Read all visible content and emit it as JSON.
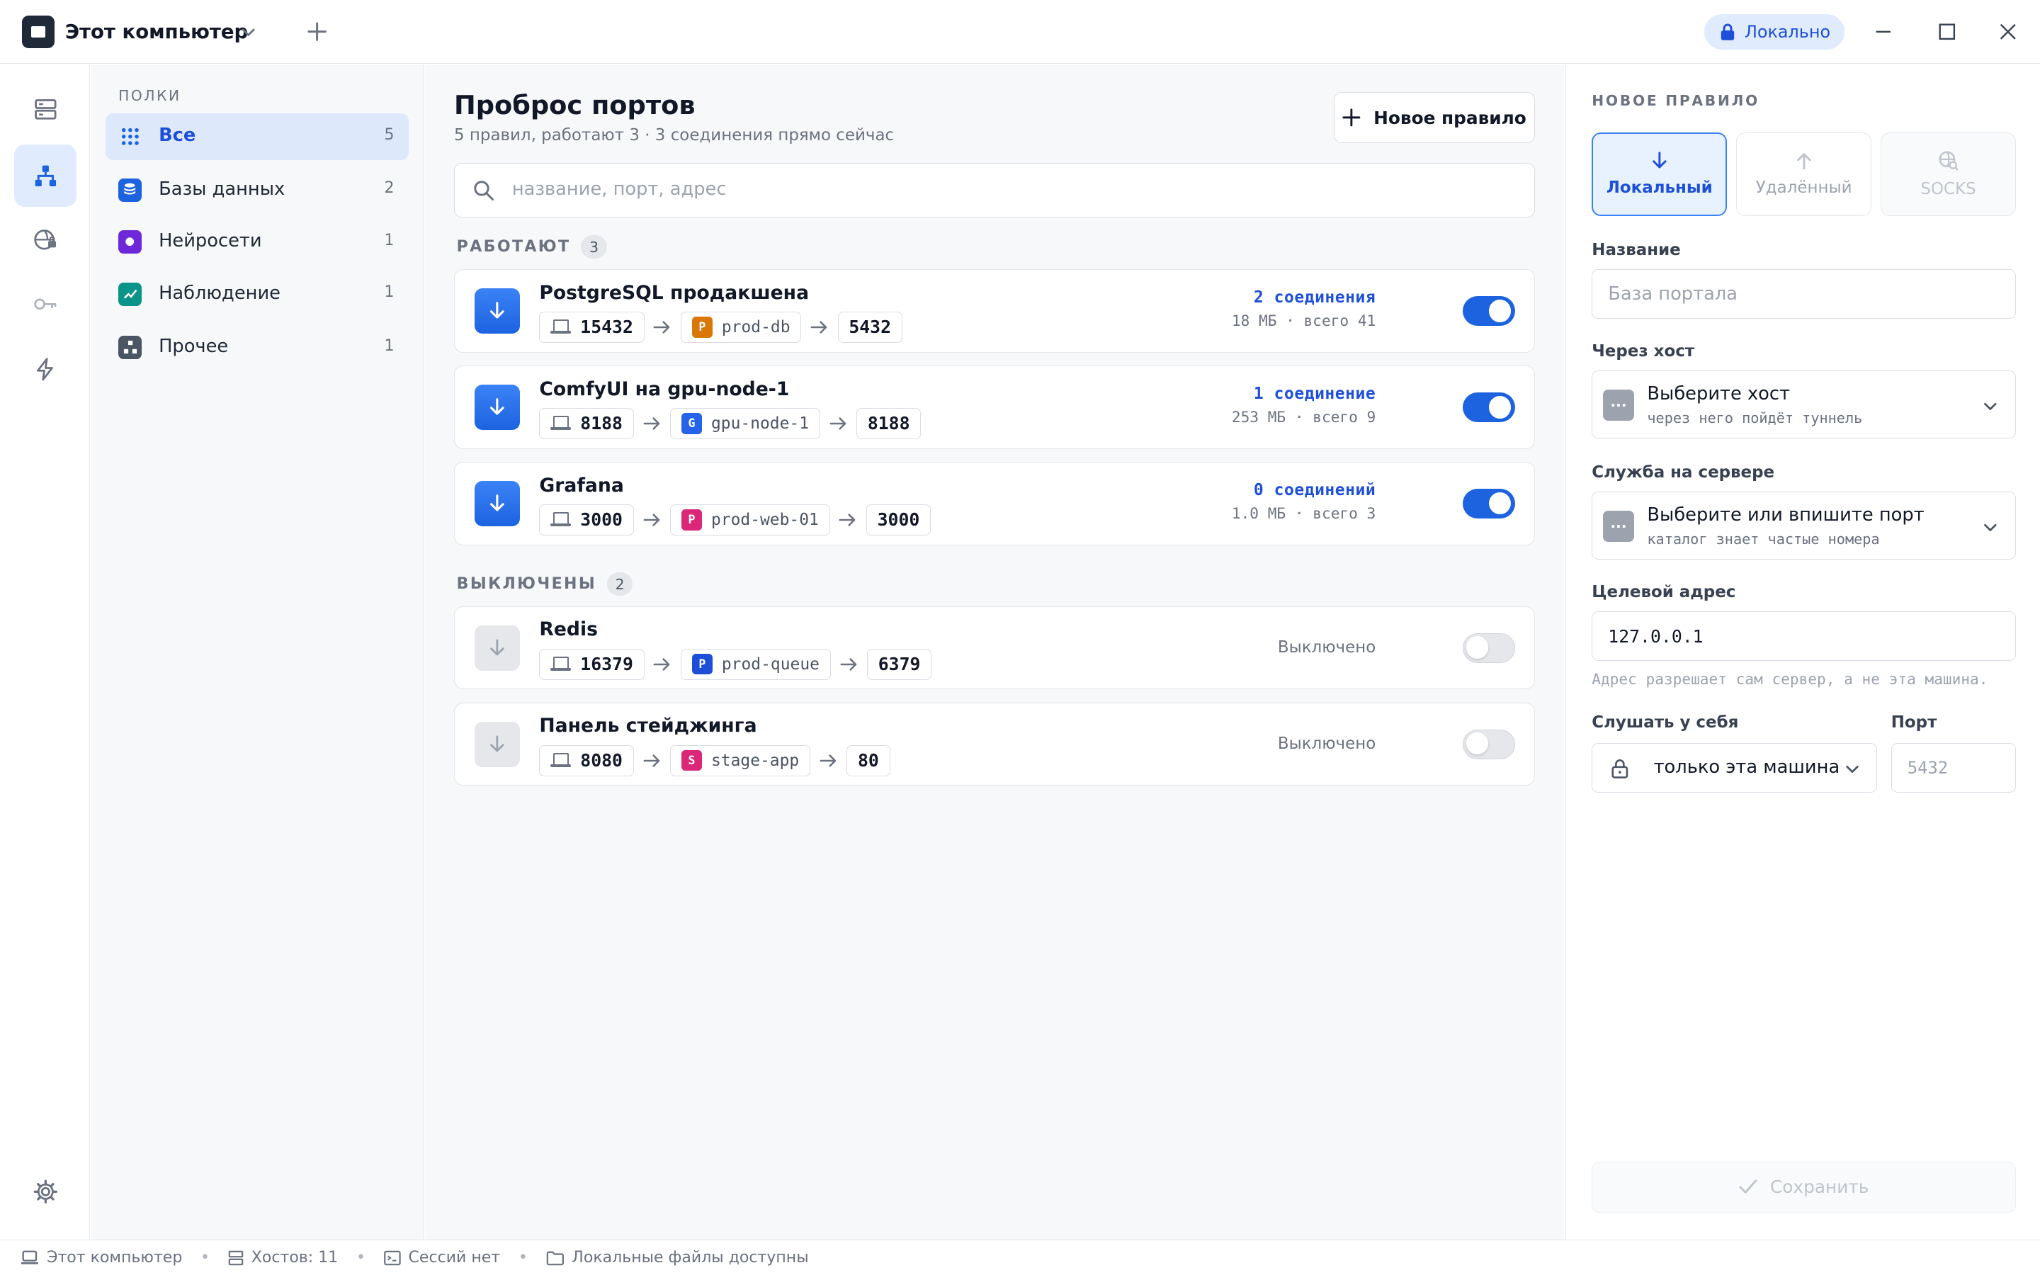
{
  "window": {
    "title": "Этот компьютер",
    "mode_badge": "Локально"
  },
  "sidebar": {
    "heading": "ПОЛКИ",
    "items": [
      {
        "label": "Все",
        "count": "5",
        "icon": "grid-icon",
        "color": "#dde9fb"
      },
      {
        "label": "Базы данных",
        "count": "2",
        "icon": "database-icon",
        "color": "#1d63e0"
      },
      {
        "label": "Нейросети",
        "count": "1",
        "icon": "ai-icon",
        "color": "#6d28d9"
      },
      {
        "label": "Наблюдение",
        "count": "1",
        "icon": "chart-icon",
        "color": "#0d9488"
      },
      {
        "label": "Прочее",
        "count": "1",
        "icon": "other-icon",
        "color": "#4b5563"
      }
    ]
  },
  "main": {
    "title": "Проброс портов",
    "subtitle": "5 правил, работают 3 · 3 соединения прямо сейчас",
    "new_rule_label": "Новое правило",
    "search_placeholder": "название, порт, адрес",
    "running_header": "РАБОТАЮТ",
    "running_count": "3",
    "off_header": "ВЫКЛЮЧЕНЫ",
    "off_count": "2",
    "rules": [
      {
        "name": "PostgreSQL продакшена",
        "local_port": "15432",
        "host": "prod-db",
        "host_letter": "P",
        "host_color": "#d97706",
        "remote_port": "5432",
        "connections": "2 соединения",
        "traffic": "18 МБ · всего 41",
        "enabled": true
      },
      {
        "name": "ComfyUI на gpu-node-1",
        "local_port": "8188",
        "host": "gpu-node-1",
        "host_letter": "G",
        "host_color": "#2563eb",
        "remote_port": "8188",
        "connections": "1 соединение",
        "traffic": "253 МБ · всего 9",
        "enabled": true
      },
      {
        "name": "Grafana",
        "local_port": "3000",
        "host": "prod-web-01",
        "host_letter": "P",
        "host_color": "#db2777",
        "remote_port": "3000",
        "connections": "0 соединений",
        "traffic": "1.0 МБ · всего 3",
        "enabled": true
      },
      {
        "name": "Redis",
        "local_port": "16379",
        "host": "prod-queue",
        "host_letter": "P",
        "host_color": "#1d4ed8",
        "remote_port": "6379",
        "status": "Выключено",
        "enabled": false
      },
      {
        "name": "Панель стейджинга",
        "local_port": "8080",
        "host": "stage-app",
        "host_letter": "S",
        "host_color": "#db2777",
        "remote_port": "80",
        "status": "Выключено",
        "enabled": false
      }
    ]
  },
  "panel": {
    "heading": "НОВОЕ ПРАВИЛО",
    "modes": [
      {
        "label": "Локальный",
        "state": "active"
      },
      {
        "label": "Удалённый",
        "state": "inactive"
      },
      {
        "label": "SOCKS",
        "state": "disabled"
      }
    ],
    "name_label": "Название",
    "name_placeholder": "База портала",
    "host_label": "Через хост",
    "host_select": "Выберите хост",
    "host_hint": "через него пойдёт туннель",
    "service_label": "Служба на сервере",
    "service_select": "Выберите или впишите порт",
    "service_hint": "каталог знает частые номера",
    "target_label": "Целевой адрес",
    "target_value": "127.0.0.1",
    "target_hint": "Адрес разрешает сам сервер, а не эта машина.",
    "listen_label": "Слушать у себя",
    "listen_value": "только эта машина",
    "port_label": "Порт",
    "port_placeholder": "5432",
    "save_label": "Сохранить"
  },
  "statusbar": {
    "computer": "Этот компьютер",
    "hosts": "Хостов: 11",
    "sessions": "Сессий нет",
    "files": "Локальные файлы доступны"
  }
}
